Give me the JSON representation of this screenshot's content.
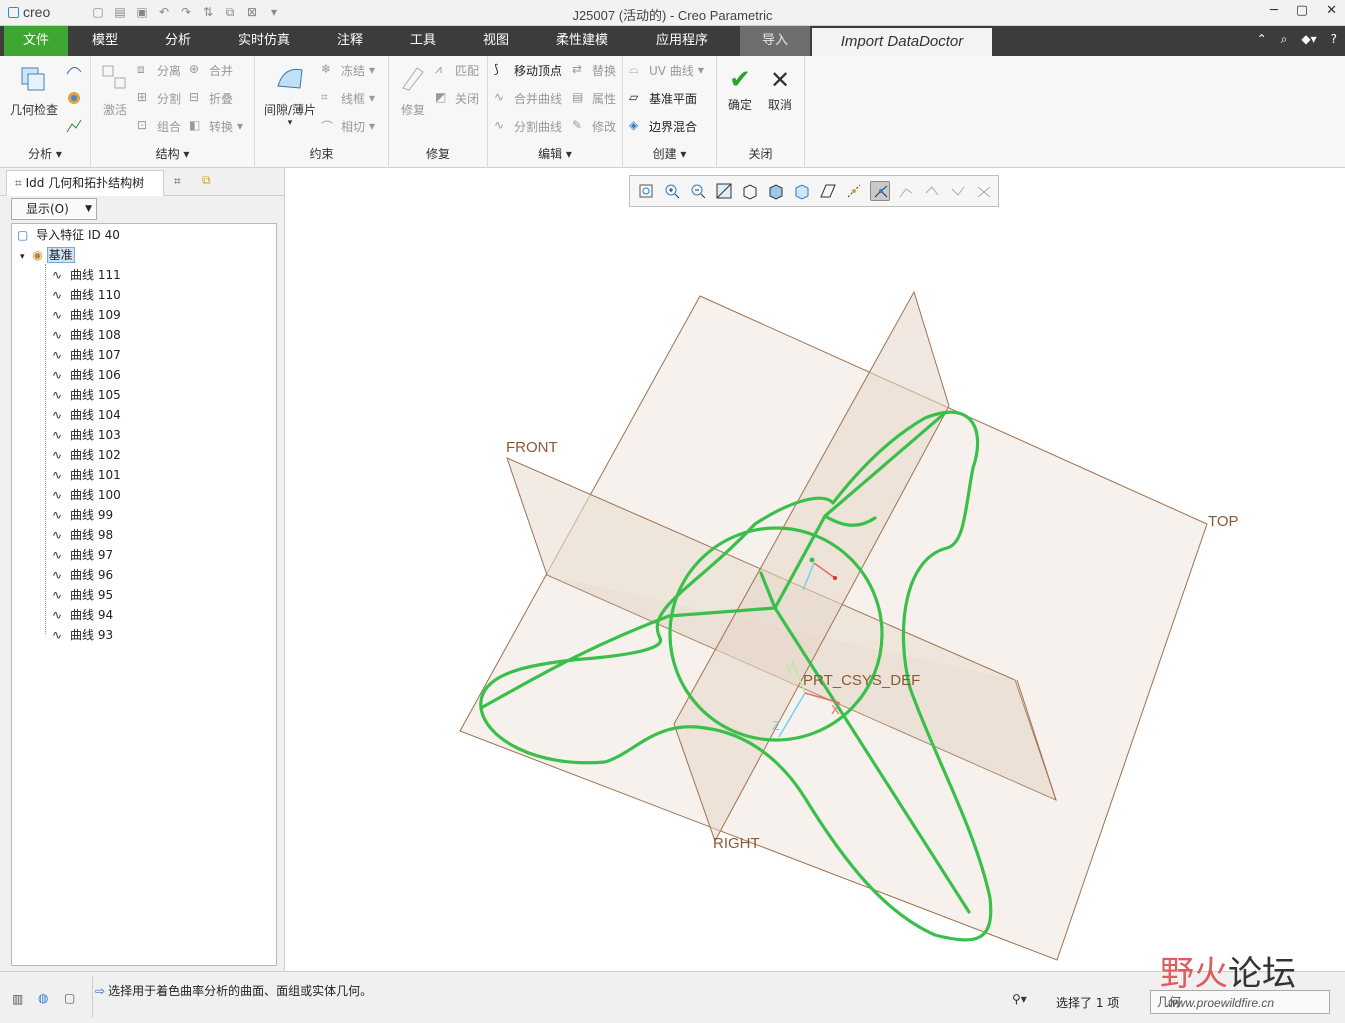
{
  "window": {
    "title": "J25007 (活动的) - Creo Parametric",
    "logo": "creo"
  },
  "menu": {
    "tabs": [
      "文件",
      "模型",
      "分析",
      "实时仿真",
      "注释",
      "工具",
      "视图",
      "柔性建模",
      "应用程序",
      "导入",
      "Import DataDoctor"
    ]
  },
  "ribbon": {
    "groups": {
      "analysis": "分析",
      "structure": "结构",
      "constraint": "约束",
      "repair": "修复",
      "edit": "编辑",
      "create": "创建",
      "close": "关闭"
    },
    "buttons": {
      "geom_check": "几何检查",
      "activate": "激活",
      "separate": "分离",
      "merge": "合并",
      "split": "分割",
      "fold": "折叠",
      "combine": "组合",
      "convert": "转换",
      "gap_thin": "间隙/薄片",
      "freeze": "冻结",
      "wireframe": "线框",
      "tangent": "相切",
      "repair": "修复",
      "match": "匹配",
      "close_small": "关闭",
      "move_vertex": "移动顶点",
      "replace": "替换",
      "merge_curve": "合并曲线",
      "properties": "属性",
      "split_curve": "分割曲线",
      "modify": "修改",
      "uv_curve": "UV 曲线",
      "datum_plane": "基准平面",
      "boundary_blend": "边界混合",
      "ok": "确定",
      "cancel": "取消"
    }
  },
  "leftpanel": {
    "tab_label": "Idd 几何和拓扑结构树",
    "show_label": "显示(O)",
    "tree": {
      "root": "导入特征 ID 40",
      "datum": "基准",
      "curves": [
        "曲线 111",
        "曲线 110",
        "曲线 109",
        "曲线 108",
        "曲线 107",
        "曲线 106",
        "曲线 105",
        "曲线 104",
        "曲线 103",
        "曲线 102",
        "曲线 101",
        "曲线 100",
        "曲线 99",
        "曲线 98",
        "曲线 97",
        "曲线 96",
        "曲线 95",
        "曲线 94",
        "曲线 93"
      ]
    }
  },
  "viewport": {
    "labels": {
      "front": "FRONT",
      "top": "TOP",
      "right": "RIGHT",
      "csys": "PRT_CSYS_DEF",
      "axis_y": "Y",
      "axis_z": "Z",
      "axis_x": "X"
    },
    "colors": {
      "plane_edge": "#a0714f",
      "plane_fill": "#efe6dc",
      "curve": "#3ac04a"
    }
  },
  "statusbar": {
    "message": "选择用于着色曲率分析的曲面、面组或实体几何。",
    "selection": "选择了 1 项",
    "filter": "几何"
  },
  "watermark": {
    "text_a": "野火",
    "text_b": "论坛",
    "url": "www.proewildfire.cn"
  }
}
